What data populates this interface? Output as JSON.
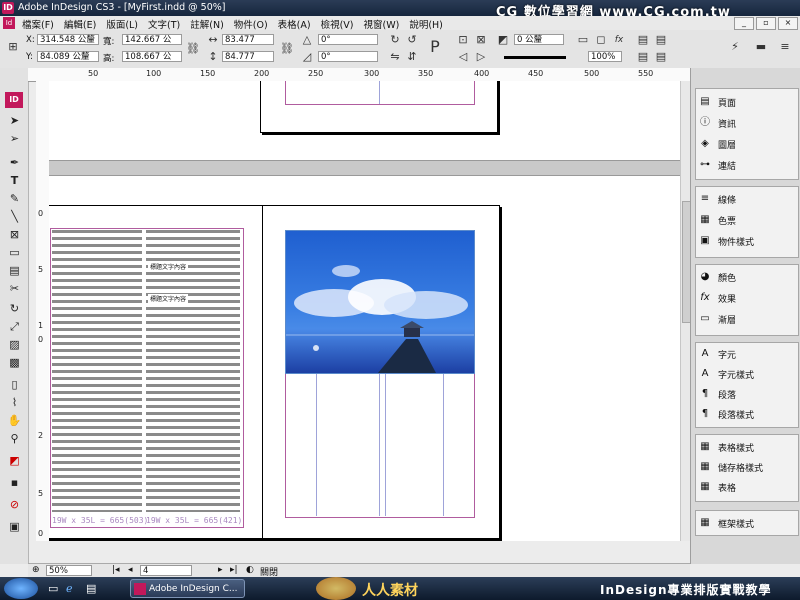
{
  "title_bar": {
    "app_title": "Adobe InDesign CS3 - [MyFirst.indd @ 50%]",
    "watermark": "CG 數位學習網 www.CG.com.tw",
    "logo": "ID"
  },
  "menu": {
    "items": [
      "檔案(F)",
      "編輯(E)",
      "版面(L)",
      "文字(T)",
      "註解(N)",
      "物件(O)",
      "表格(A)",
      "檢視(V)",
      "視窗(W)",
      "說明(H)"
    ],
    "window_buttons": [
      "_",
      "▫",
      "×"
    ]
  },
  "control_panel": {
    "x_label": "X:",
    "x_value": "314.548 公釐",
    "y_label": "Y:",
    "y_value": "84.089 公釐",
    "w_label": "寬:",
    "w_value": "142.667 公",
    "h_label": "高:",
    "h_value": "108.667 公",
    "scale_x": "83.477",
    "scale_y": "84.777",
    "rotate": "0°",
    "shear": "0°",
    "stroke_weight": "0 公釐",
    "opacity": "100%"
  },
  "rulers": {
    "h_ticks": [
      "50",
      "100",
      "150",
      "200",
      "250",
      "300",
      "350",
      "400",
      "450",
      "500",
      "550"
    ],
    "v_ticks": [
      "0",
      "5",
      "1",
      "0",
      "2",
      "5",
      "0"
    ]
  },
  "panels": {
    "group1": [
      {
        "icon": "pages-icon",
        "glyph": "▤",
        "label": "頁面"
      },
      {
        "icon": "info-icon",
        "glyph": "ⓘ",
        "label": "資訊"
      },
      {
        "icon": "layers-icon",
        "glyph": "◈",
        "label": "圖層"
      },
      {
        "icon": "links-icon",
        "glyph": "⊶",
        "label": "連結"
      }
    ],
    "group2": [
      {
        "icon": "stroke-icon",
        "glyph": "≡",
        "label": "線條"
      },
      {
        "icon": "swatches-icon",
        "glyph": "▦",
        "label": "色票"
      },
      {
        "icon": "object-styles-icon",
        "glyph": "▣",
        "label": "物件樣式"
      }
    ],
    "group3": [
      {
        "icon": "color-icon",
        "glyph": "◕",
        "label": "顏色"
      },
      {
        "icon": "effects-icon",
        "glyph": "fx",
        "label": "效果"
      },
      {
        "icon": "gradient-icon",
        "glyph": "▭",
        "label": "漸層"
      }
    ],
    "group4": [
      {
        "icon": "character-icon",
        "glyph": "A",
        "label": "字元"
      },
      {
        "icon": "character-styles-icon",
        "glyph": "A",
        "label": "字元樣式"
      },
      {
        "icon": "paragraph-icon",
        "glyph": "¶",
        "label": "段落"
      },
      {
        "icon": "paragraph-styles-icon",
        "glyph": "¶",
        "label": "段落樣式"
      }
    ],
    "group5": [
      {
        "icon": "table-styles-icon",
        "glyph": "▦",
        "label": "表格樣式"
      },
      {
        "icon": "cell-styles-icon",
        "glyph": "▦",
        "label": "儲存格樣式"
      },
      {
        "icon": "table-icon",
        "glyph": "▦",
        "label": "表格"
      }
    ],
    "group6": [
      {
        "icon": "anchored-styles-icon",
        "glyph": "▦",
        "label": "框架樣式"
      }
    ]
  },
  "document": {
    "frame_caption_1": "19W x 35L = 665(503)",
    "frame_caption_2": "19W x 35L = 665(421)",
    "heading_a": "標題文字內容",
    "heading_b": "標題文字內容"
  },
  "status": {
    "zoom": "50%",
    "page": "4",
    "state": "關閉"
  },
  "taskbar": {
    "task": "Adobe InDesign C...",
    "site_watermark": "人人素材",
    "course_title": "InDesign專業排版實戰教學"
  },
  "colors": {
    "title_bg": "#1d2d44",
    "indesign_pink": "#c2185b",
    "margin_guide": "#b05c9e",
    "column_guide": "#9ea3d9"
  }
}
